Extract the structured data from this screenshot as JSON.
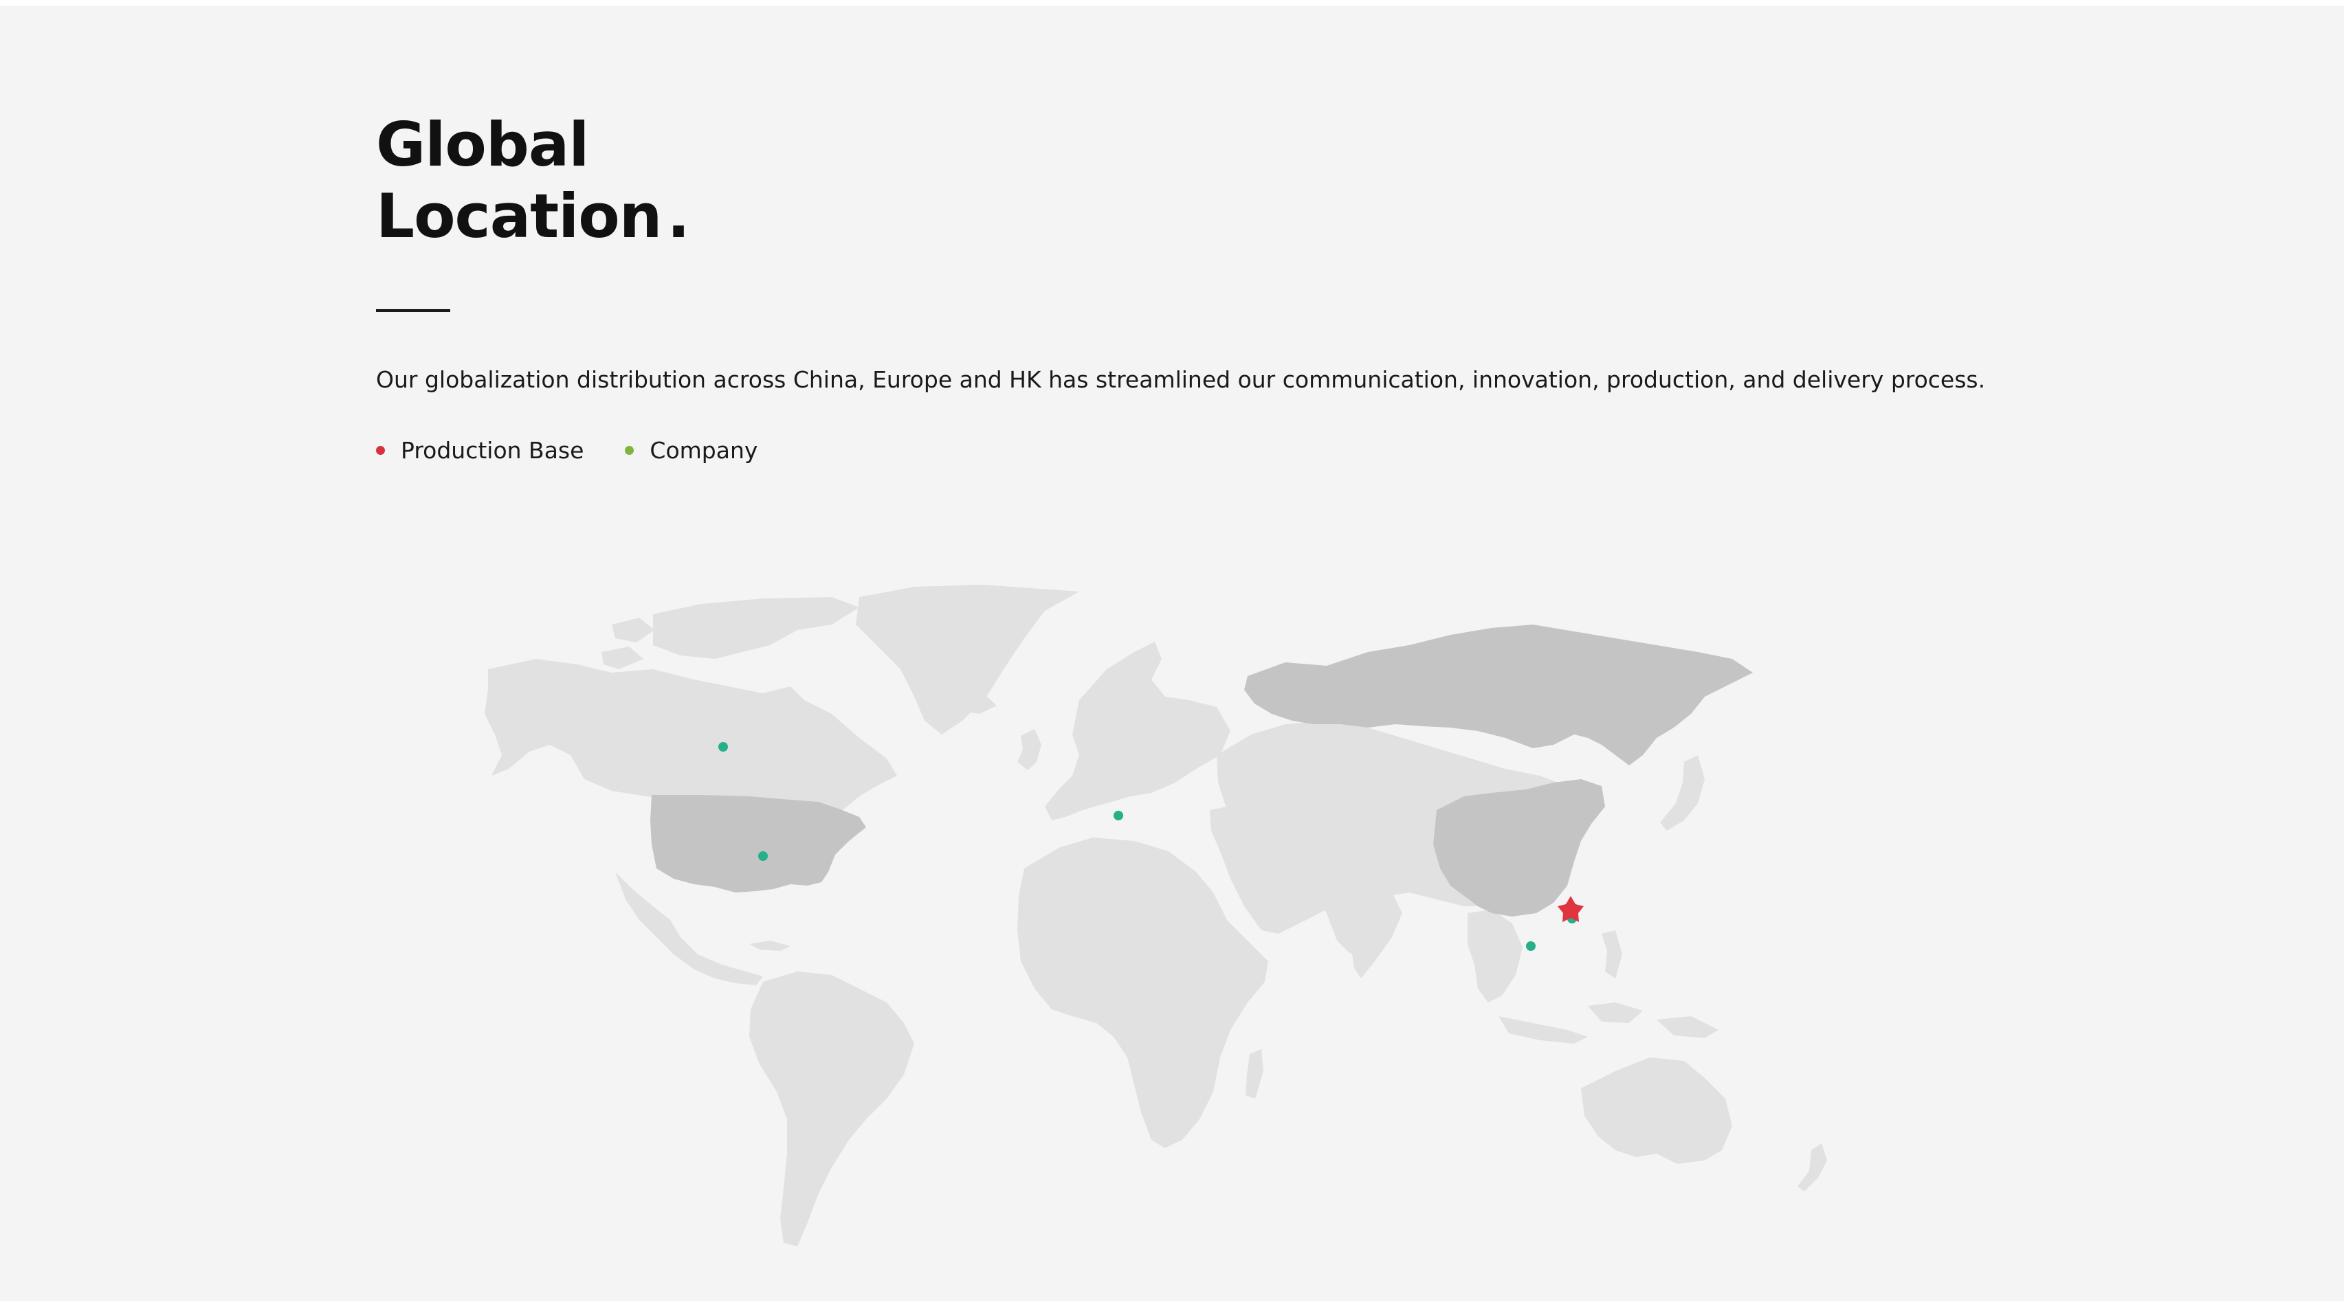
{
  "header": {
    "title_line1": "Global",
    "title_line2": "Location",
    "title_dot": "."
  },
  "description": "Our globalization distribution across China, Europe and HK has streamlined our communication, innovation, production, and delivery process.",
  "legend": [
    {
      "label": "Production Base",
      "color": "#d6323e"
    },
    {
      "label": "Company",
      "color": "#7fb53a"
    }
  ],
  "map": {
    "land_color": "#e1e1e1",
    "highlight_color": "#c4c4c4",
    "markers": [
      {
        "name": "marker-canada",
        "type": "Company"
      },
      {
        "name": "marker-usa",
        "type": "Company"
      },
      {
        "name": "marker-europe",
        "type": "Company"
      },
      {
        "name": "marker-hong-kong",
        "type": "Company"
      },
      {
        "name": "marker-vietnam",
        "type": "Company"
      },
      {
        "name": "marker-china-production",
        "type": "Production Base"
      }
    ],
    "company_marker_color": "#26b08a",
    "production_marker_color": "#e0343f"
  }
}
